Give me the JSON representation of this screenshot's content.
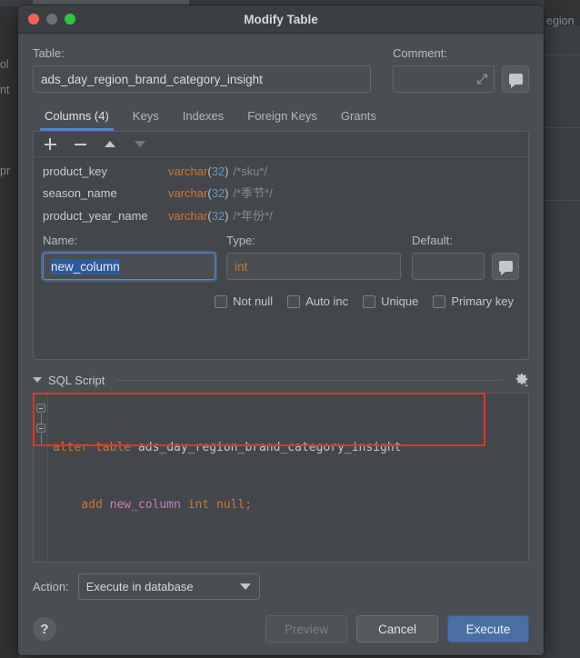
{
  "backdrop": {
    "fragment_right": "egion",
    "fragment_left_1": "ol",
    "fragment_left_2": "nt",
    "fragment_left_3": "pr"
  },
  "window": {
    "title": "Modify Table",
    "traffic_lights": [
      "close-button",
      "minimize-button",
      "maximize-button"
    ]
  },
  "table_section": {
    "table_label": "Table:",
    "table_value": "ads_day_region_brand_category_insight",
    "comment_label": "Comment:",
    "comment_value": "",
    "comment_placeholder": "",
    "expand_icon": "expand-diagonal-icon",
    "comment_button_icon": "comment-bubble-icon"
  },
  "tabs": [
    {
      "label": "Columns (4)",
      "active": true
    },
    {
      "label": "Keys",
      "active": false
    },
    {
      "label": "Indexes",
      "active": false
    },
    {
      "label": "Foreign Keys",
      "active": false
    },
    {
      "label": "Grants",
      "active": false
    }
  ],
  "columns_toolbar": [
    {
      "icon": "add-column-icon",
      "enabled": true
    },
    {
      "icon": "remove-column-icon",
      "enabled": true
    },
    {
      "icon": "move-up-icon",
      "enabled": true
    },
    {
      "icon": "move-down-icon",
      "enabled": false
    }
  ],
  "columns": [
    {
      "name": "product_key",
      "type": "varchar",
      "length": "32",
      "comment": "/*sku*/"
    },
    {
      "name": "season_name",
      "type": "varchar",
      "length": "32",
      "comment": "/*季节*/"
    },
    {
      "name": "product_year_name",
      "type": "varchar",
      "length": "32",
      "comment": "/*年份*/"
    }
  ],
  "column_editor": {
    "name_label": "Name:",
    "name_value": "new_column",
    "name_selected": true,
    "type_label": "Type:",
    "type_value": "int",
    "default_label": "Default:",
    "default_value": "",
    "default_button_icon": "comment-bubble-icon",
    "checkboxes": [
      {
        "label": "Not null",
        "checked": false
      },
      {
        "label": "Auto inc",
        "checked": false
      },
      {
        "label": "Unique",
        "checked": false
      },
      {
        "label": "Primary key",
        "checked": false
      }
    ]
  },
  "sql_section": {
    "title": "SQL Script",
    "collapse_icon": "caret-down-icon",
    "settings_icon": "gear-icon",
    "lines": [
      {
        "tokens": [
          {
            "t": "alter table ",
            "c": "kw"
          },
          {
            "t": "ads_day_region_brand_category_insight",
            "c": "ident"
          }
        ]
      },
      {
        "tokens": [
          {
            "t": "    add ",
            "c": "kw"
          },
          {
            "t": "new_column",
            "c": "col-ident"
          },
          {
            "t": " int null;",
            "c": "kw"
          }
        ]
      }
    ],
    "highlight_color": "#e8322b"
  },
  "footer": {
    "action_label": "Action:",
    "action_value": "Execute in database",
    "help_label": "?",
    "buttons": [
      {
        "label": "Preview",
        "state": "disabled"
      },
      {
        "label": "Cancel",
        "state": "normal"
      },
      {
        "label": "Execute",
        "state": "primary"
      }
    ]
  }
}
